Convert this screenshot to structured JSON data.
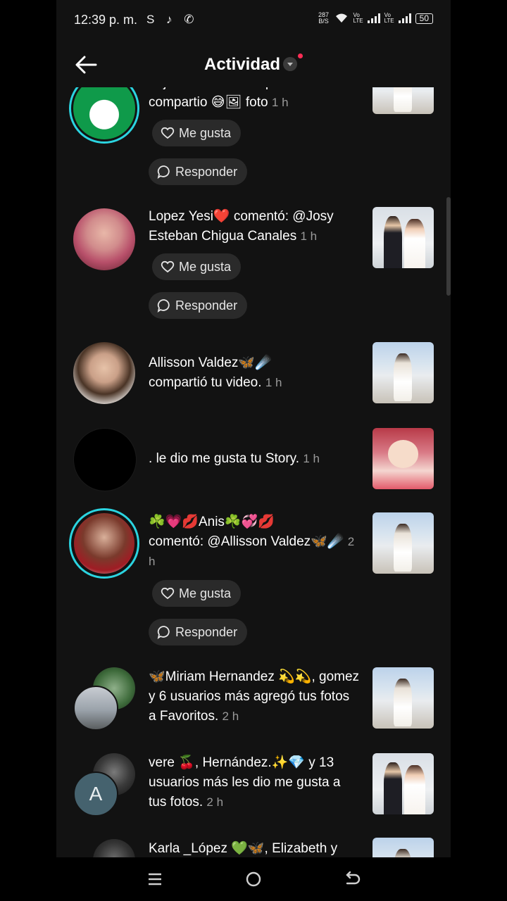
{
  "status_bar": {
    "time": "12:39 p. m.",
    "app_icons": "S ♪ ✆",
    "net_speed": "287 B/S",
    "battery": "50"
  },
  "header": {
    "title": "Actividad",
    "back_icon": "arrow-left-icon"
  },
  "actions": {
    "like_label": "Me gusta",
    "reply_label": "Responder"
  },
  "feed": [
    {
      "text": "dejó su comentario pero lo compartio 😅🖼 foto",
      "time": "1 h"
    },
    {
      "user": "Lopez Yesi❤️",
      "text": "comentó: @Josy Esteban Chigua Canales",
      "time": "1 h"
    },
    {
      "user": "Allisson Valdez🦋☄️",
      "text": "compartió tu video.",
      "time": "1 h"
    },
    {
      "user": ".",
      "text": "le dio me gusta tu Story.",
      "time": "1 h"
    },
    {
      "user": "☘️💗💋Anis☘️💞💋",
      "text": "comentó: @Allisson Valdez🦋☄️",
      "time": "2 h"
    },
    {
      "user": "🦋Miriam  Hernandez 💫💫, gomez",
      "text": "y 6 usuarios más agregó tus fotos a Favoritos.",
      "time": "2 h"
    },
    {
      "user": "vere 🍒, Hernández.✨💎",
      "text": "y 13 usuarios más les dio me gusta a tus fotos.",
      "time": "2 h"
    },
    {
      "user": "Karla _López 💚🦋, Elizabeth",
      "text": "y",
      "time": ""
    }
  ],
  "initial_avatar": "A",
  "nav": {
    "menu_icon": "recent-apps-icon",
    "home_icon": "home-circle-icon",
    "back_icon": "back-arrow-icon"
  }
}
